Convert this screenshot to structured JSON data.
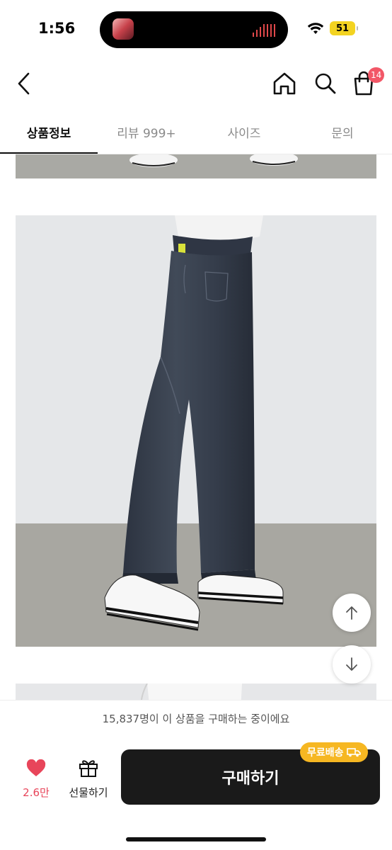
{
  "status_bar": {
    "time": "1:56",
    "battery": "51",
    "recording_color": "#e0484a"
  },
  "nav": {
    "back_icon": "chevron-left-icon",
    "home_icon": "home-icon",
    "search_icon": "search-icon",
    "cart_icon": "shopping-bag-icon",
    "cart_badge": "14"
  },
  "tabs": [
    {
      "label": "상품정보",
      "active": true
    },
    {
      "label": "리뷰 999+",
      "active": false
    },
    {
      "label": "사이즈",
      "active": false
    },
    {
      "label": "문의",
      "active": false
    }
  ],
  "notice": {
    "text": "15,837명이 이 상품을 구매하는 중이에요"
  },
  "bottom_bar": {
    "like_count": "2.6만",
    "gift_label": "선물하기",
    "buy_label": "구매하기",
    "free_shipping": "무료배송"
  },
  "colors": {
    "accent_pink": "#e8455a",
    "free_ship_yellow": "#f6b722",
    "buy_button": "#1a1a1a",
    "badge": "#f25767"
  }
}
